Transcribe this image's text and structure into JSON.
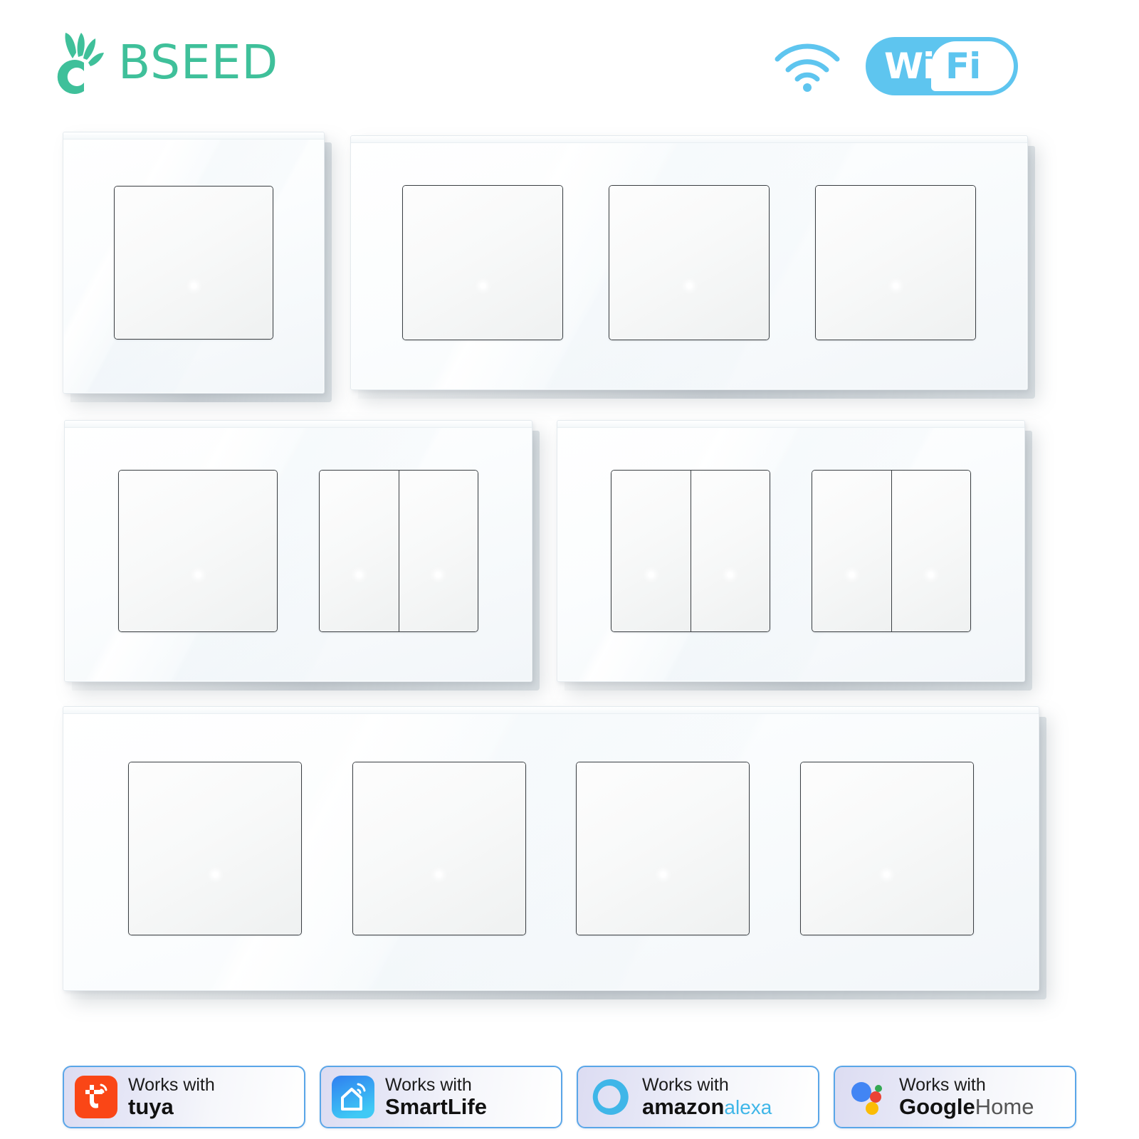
{
  "header": {
    "brand_name": "BSEED",
    "brand_color": "#3fc09a",
    "logo_icon": "sprout-c-icon",
    "wifi_icon": "wifi-signal-icon",
    "wifi_badge": {
      "left_text": "Wi",
      "right_text": "Fi",
      "color": "#5ec5ef"
    }
  },
  "panels": [
    {
      "id": "panel-1gang",
      "name": "1-gang-switch-panel",
      "gang_count": 1,
      "gangs": [
        {
          "keys": 1,
          "shape": "square"
        }
      ]
    },
    {
      "id": "panel-3gang",
      "name": "3-gang-switch-panel",
      "gang_count": 3,
      "gangs": [
        {
          "keys": 1,
          "shape": "square"
        },
        {
          "keys": 1,
          "shape": "square"
        },
        {
          "keys": 1,
          "shape": "square"
        }
      ]
    },
    {
      "id": "panel-1plus2gang",
      "name": "1-gang-plus-2-gang-switch-panel",
      "gang_count": 2,
      "gangs": [
        {
          "keys": 1,
          "shape": "square"
        },
        {
          "keys": 2,
          "shape": "square"
        }
      ]
    },
    {
      "id": "panel-2plus2gang",
      "name": "dual-2-gang-switch-panel",
      "gang_count": 2,
      "gangs": [
        {
          "keys": 2,
          "shape": "square"
        },
        {
          "keys": 2,
          "shape": "square"
        }
      ]
    },
    {
      "id": "panel-4gang",
      "name": "4-gang-switch-panel",
      "gang_count": 4,
      "gangs": [
        {
          "keys": 1,
          "shape": "tall"
        },
        {
          "keys": 1,
          "shape": "tall"
        },
        {
          "keys": 1,
          "shape": "tall"
        },
        {
          "keys": 1,
          "shape": "tall"
        }
      ]
    }
  ],
  "compatibility_badges": [
    {
      "works_label": "Works with",
      "brand": "tuya",
      "brand_suffix": "",
      "icon": "tuya-icon",
      "icon_color": "#fa4616"
    },
    {
      "works_label": "Works with",
      "brand": "SmartLife",
      "brand_suffix": "",
      "icon": "smartlife-home-icon",
      "icon_color": "#2f9bf0"
    },
    {
      "works_label": "Works with",
      "brand": "amazon",
      "brand_suffix": "alexa",
      "icon": "alexa-ring-icon",
      "icon_color": "#3fb6e8"
    },
    {
      "works_label": "Works with",
      "brand": "Google",
      "brand_suffix": "Home",
      "icon": "google-assistant-icon",
      "icon_color": "#4285f4"
    }
  ],
  "colors": {
    "brand_green": "#3fc09a",
    "wifi_blue": "#5ec5ef",
    "badge_border": "#5aa6e8",
    "button_outline": "#3b3f43",
    "led": "#ffffff",
    "tuya_orange": "#fa4616",
    "google_blue": "#4285f4",
    "google_red": "#ea4335",
    "google_green": "#34a853",
    "google_yellow": "#fbbc05"
  }
}
